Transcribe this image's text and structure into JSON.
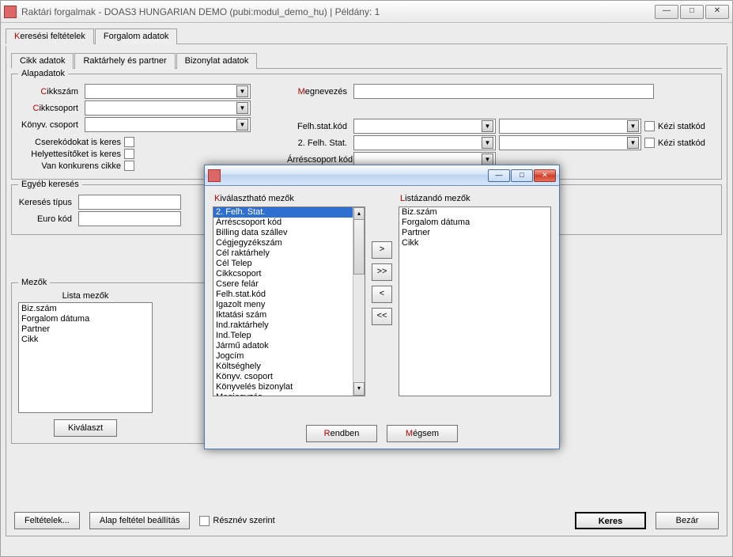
{
  "main": {
    "title": "Raktári forgalmak - DOAS3 HUNGARIAN DEMO (pubi:modul_demo_hu) | Példány: 1",
    "win": {
      "min": "—",
      "max": "□",
      "close": "✕"
    },
    "tabs1": {
      "keresesi": "Keresési feltételek",
      "forgalom": "Forgalom adatok"
    },
    "tabs2": {
      "cikk": "Cikk adatok",
      "raktar": "Raktárhely és partner",
      "biz": "Bizonylat adatok"
    },
    "alapadatok": {
      "title": "Alapadatok",
      "cikkszam": "Cikkszám",
      "megnevezes": "Megnevezés",
      "cikkcsoport": "Cikkcsoport",
      "konyvcsoport": "Könyv. csoport",
      "felhstat": "Felh.stat.kód",
      "felh2": "2. Felh. Stat.",
      "arres": "Árréscsoport kód",
      "kezi": "Kézi statkód",
      "csere": "Cserekódokat is keres",
      "helyett": "Helyettesítőket is keres",
      "vankonk": "Van konkurens cikke"
    },
    "egyeb": {
      "title": "Egyéb keresés",
      "kerestipus": "Keresés típus",
      "eurokod": "Euro kód"
    },
    "mezok": {
      "title": "Mezők",
      "lista": "Lista mezők",
      "items": [
        "Biz.szám",
        "Forgalom dátuma",
        "Partner",
        "Cikk"
      ],
      "kivalaszt": "Kiválaszt"
    },
    "bottom": {
      "feltetelek": "Feltételek...",
      "alap": "Alap feltétel beállítás",
      "resznev": "Résznév szerint",
      "keres": "Keres",
      "bezar": "Bezár"
    }
  },
  "dialog": {
    "leftTitle": "Kiválasztható mezők",
    "rightTitle": "Listázandó mezők",
    "leftItems": [
      "2. Felh. Stat.",
      "Árréscsoport kód",
      "Billing data szállev",
      "Cégjegyzékszám",
      "Cél raktárhely",
      "Cél Telep",
      "Cikkcsoport",
      "Csere felár",
      "Felh.stat.kód",
      "Igazolt meny",
      "Iktatási szám",
      "Ind.raktárhely",
      "Ind.Telep",
      "Jármű adatok",
      "Jogcím",
      "Költséghely",
      "Könyv. csoport",
      "Könyvelés bizonylat",
      "Megjegyzés"
    ],
    "rightItems": [
      "Biz.szám",
      "Forgalom dátuma",
      "Partner",
      "Cikk"
    ],
    "buttons": {
      "right": ">",
      "rightAll": ">>",
      "left": "<",
      "leftAll": "<<"
    },
    "footer": {
      "ok": "Rendben",
      "cancel": "Mégsem"
    }
  }
}
